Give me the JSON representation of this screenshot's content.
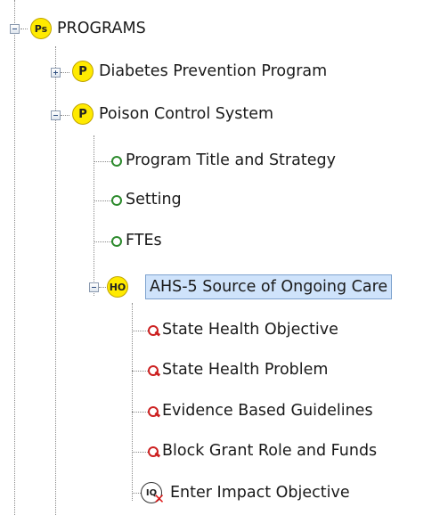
{
  "tree": {
    "root": {
      "label": "PROGRAMS",
      "icon": "program-set-icon",
      "icon_text": "Ps",
      "expanded": true
    },
    "programs": [
      {
        "label": "Diabetes Prevention Program",
        "icon": "program-icon",
        "icon_text": "P",
        "expanded": false
      },
      {
        "label": "Poison Control System",
        "icon": "program-icon",
        "icon_text": "P",
        "expanded": true
      }
    ],
    "sections": [
      {
        "label": "Program Title and Strategy",
        "icon": "green-circle-icon"
      },
      {
        "label": "Setting",
        "icon": "green-circle-icon"
      },
      {
        "label": "FTEs",
        "icon": "green-circle-icon"
      }
    ],
    "objective": {
      "label": "AHS-5 Source of Ongoing Care",
      "icon": "health-objective-icon",
      "icon_text": "HO",
      "selected": true,
      "expanded": true
    },
    "objective_items": [
      {
        "label": "State Health Objective",
        "icon": "red-error-circle-icon"
      },
      {
        "label": "State Health Problem",
        "icon": "red-error-circle-icon"
      },
      {
        "label": "Evidence Based Guidelines",
        "icon": "red-error-circle-icon"
      },
      {
        "label": "Block Grant Role and Funds",
        "icon": "red-error-circle-icon"
      },
      {
        "label": "Enter Impact Objective",
        "icon": "impact-objective-icon",
        "icon_text": "IQ"
      }
    ]
  },
  "colors": {
    "selection_bg": "#cfe3fb",
    "selection_border": "#7da2ce",
    "program_icon": "#ffea00",
    "ok_status": "#2c8a2c",
    "error_status": "#cc1f1f"
  }
}
